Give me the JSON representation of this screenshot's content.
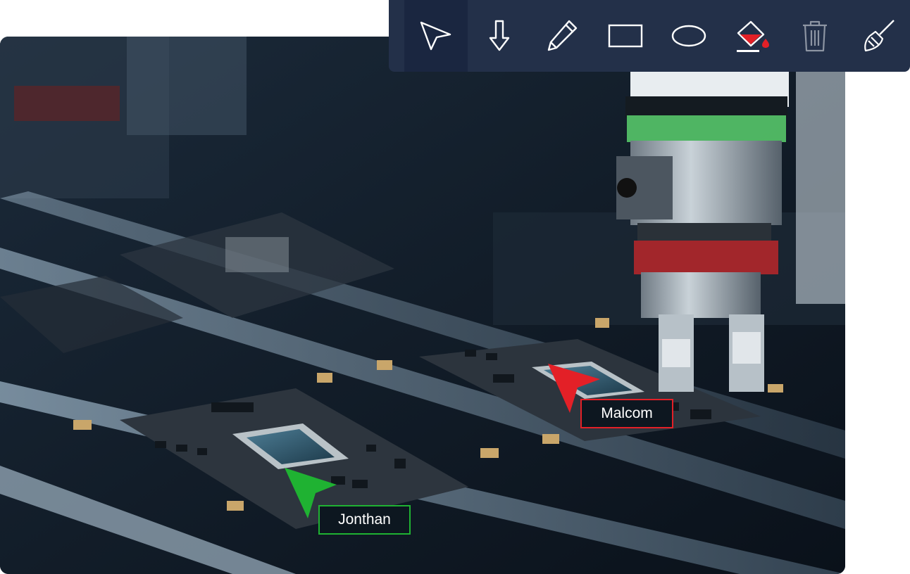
{
  "toolbar": {
    "tools": [
      {
        "name": "select",
        "icon": "pointer-icon",
        "active": true
      },
      {
        "name": "arrow",
        "icon": "arrow-down-icon"
      },
      {
        "name": "pencil",
        "icon": "pencil-icon"
      },
      {
        "name": "rectangle",
        "icon": "rectangle-icon"
      },
      {
        "name": "ellipse",
        "icon": "ellipse-icon"
      },
      {
        "name": "fill",
        "icon": "paint-bucket-icon",
        "color": "#e32027"
      },
      {
        "name": "delete",
        "icon": "trash-icon",
        "disabled": true
      },
      {
        "name": "clear",
        "icon": "broom-icon"
      }
    ]
  },
  "collaborators": [
    {
      "name": "Malcom",
      "color": "#e32027"
    },
    {
      "name": "Jonthan",
      "color": "#1fb232"
    }
  ],
  "colors": {
    "toolbar_bg": "#233049",
    "active_tool_bg": "#1a2640",
    "icon": "#ffffff"
  }
}
